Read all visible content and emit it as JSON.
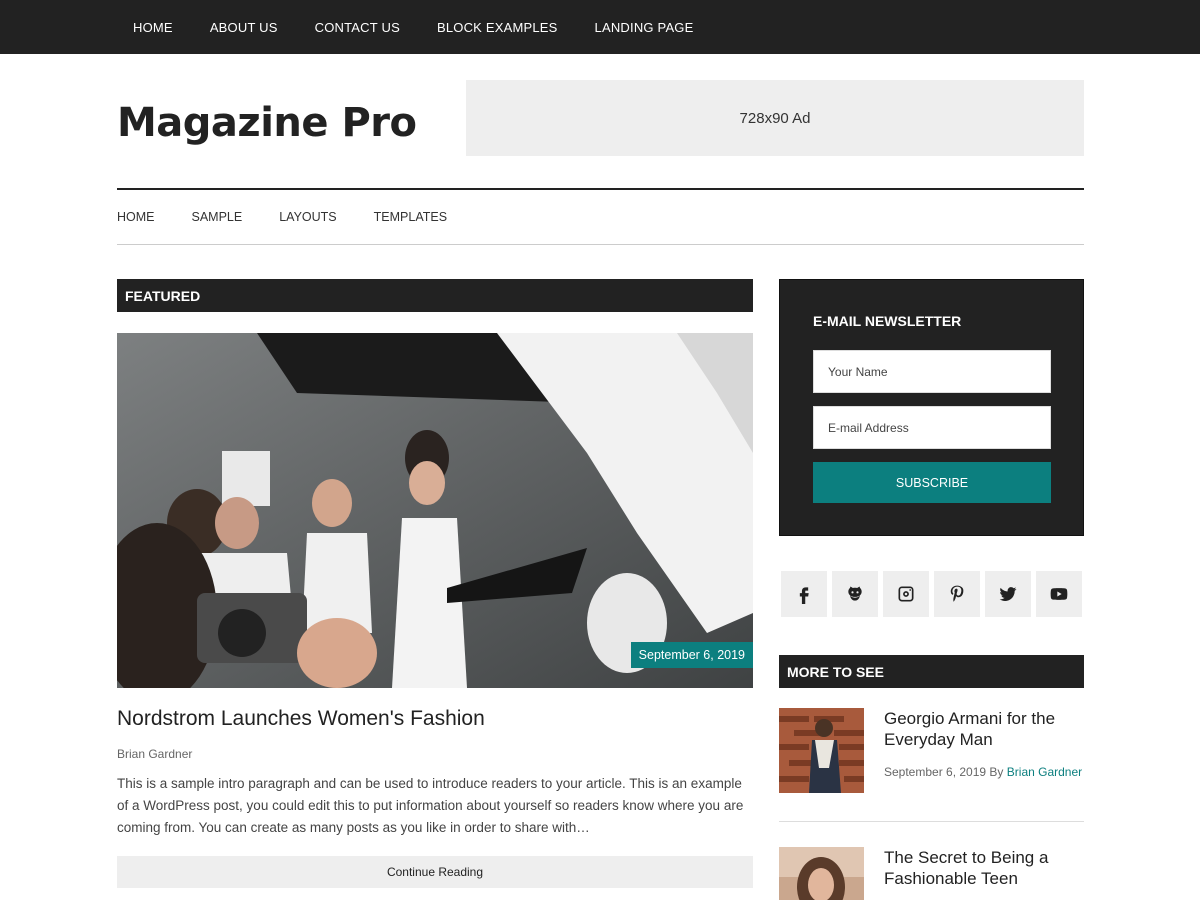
{
  "top_nav": {
    "items": [
      "HOME",
      "ABOUT US",
      "CONTACT US",
      "BLOCK EXAMPLES",
      "LANDING PAGE"
    ]
  },
  "header": {
    "site_title": "Magazine Pro",
    "ad_text": "728x90 Ad"
  },
  "sub_nav": {
    "items": [
      "HOME",
      "SAMPLE",
      "LAYOUTS",
      "TEMPLATES"
    ]
  },
  "featured": {
    "section_title": "FEATURED",
    "date": "September 6, 2019",
    "title": "Nordstrom Launches Women's Fashion",
    "author": "Brian Gardner",
    "excerpt": "This is a sample intro paragraph and can be used to introduce readers to your article. This is an example of a WordPress post, you could edit this to put information about yourself so readers know where you are coming from. You can create as many posts as you like in order to share with…",
    "continue_label": "Continue Reading"
  },
  "newsletter": {
    "title": "E-MAIL NEWSLETTER",
    "name_placeholder": "Your Name",
    "email_placeholder": "E-mail Address",
    "subscribe_label": "SUBSCRIBE"
  },
  "social": {
    "icons": [
      "facebook-icon",
      "github-icon",
      "instagram-icon",
      "pinterest-icon",
      "twitter-icon",
      "youtube-icon"
    ]
  },
  "more_to_see": {
    "section_title": "MORE TO SEE",
    "items": [
      {
        "title": "Georgio Armani for the Everyday Man",
        "date": "September 6, 2019",
        "by_label": "By",
        "author": "Brian Gardner"
      },
      {
        "title": "The Secret to Being a Fashionable Teen"
      }
    ]
  },
  "colors": {
    "accent": "#0c7f7f",
    "dark": "#222222",
    "light_gray": "#eeeeee"
  }
}
